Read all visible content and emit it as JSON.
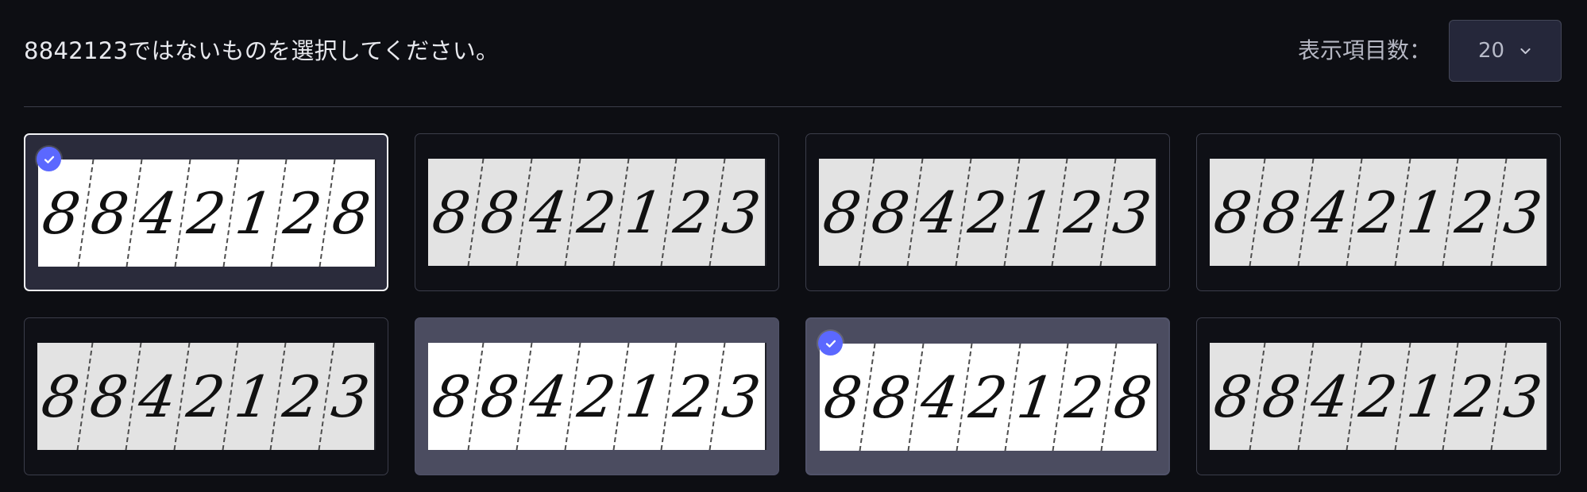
{
  "prompt": {
    "text": "8842123ではないものを選択してください。"
  },
  "display_count": {
    "label": "表示項目数：",
    "value": "20",
    "icon": "chevron-down-icon"
  },
  "cards": [
    {
      "digits": [
        "8",
        "8",
        "4",
        "2",
        "1",
        "2",
        "8"
      ],
      "selected": true,
      "state": "selected",
      "background": "white"
    },
    {
      "digits": [
        "8",
        "8",
        "4",
        "2",
        "1",
        "2",
        "3"
      ],
      "selected": false,
      "state": "normal",
      "background": "grey"
    },
    {
      "digits": [
        "8",
        "8",
        "4",
        "2",
        "1",
        "2",
        "3"
      ],
      "selected": false,
      "state": "normal",
      "background": "grey"
    },
    {
      "digits": [
        "8",
        "8",
        "4",
        "2",
        "1",
        "2",
        "3"
      ],
      "selected": false,
      "state": "normal",
      "background": "grey"
    },
    {
      "digits": [
        "8",
        "8",
        "4",
        "2",
        "1",
        "2",
        "3"
      ],
      "selected": false,
      "state": "normal",
      "background": "grey"
    },
    {
      "digits": [
        "8",
        "8",
        "4",
        "2",
        "1",
        "2",
        "3"
      ],
      "selected": false,
      "state": "hovered",
      "background": "white"
    },
    {
      "digits": [
        "8",
        "8",
        "4",
        "2",
        "1",
        "2",
        "8"
      ],
      "selected": true,
      "state": "selected-hovered",
      "background": "white"
    },
    {
      "digits": [
        "8",
        "8",
        "4",
        "2",
        "1",
        "2",
        "3"
      ],
      "selected": false,
      "state": "normal",
      "background": "grey"
    }
  ],
  "colors": {
    "page_background": "#0d0e13",
    "check_badge": "#5b68ff",
    "selected_border": "#f3f4f7",
    "hover_background": "#4b4c60"
  }
}
